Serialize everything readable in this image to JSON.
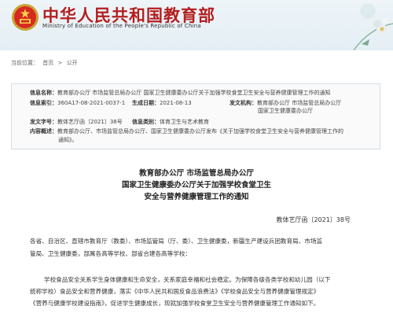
{
  "header": {
    "title": "中华人民共和国教育部",
    "subtitle": "Ministry of Education of the People's Republic of China",
    "emblem_icon": "national-emblem-icon",
    "colors": {
      "title": "#b31f1f",
      "background": "#eef5f9"
    }
  },
  "breadcrumb": {
    "label": "当前位置：",
    "home": "首页",
    "sep": ">",
    "current": "公开"
  },
  "info": {
    "title_label": "信息名称：",
    "title_value": "教育部办公厅  市场监管总局办公厅  国家卫生健康委办公厅关于加强学校食堂卫生安全与营养健康管理工作的通知",
    "index_label": "信息索引：",
    "index_value": "360A17-08-2021-0037-1",
    "date_label": "生成日期：",
    "date_value": "2021-08-13",
    "org_label": "发文机构：",
    "org_value": "教育部办公厅  市场监管总局办公厅",
    "org_value2": "国家卫生健康委办公厅",
    "docno_label": "发文字号：",
    "docno_value": "教体艺厅函〔2021〕38号",
    "category_label": "信息类别：",
    "category_value": "体育卫生与艺术教育",
    "summary_label": "内容概述：",
    "summary_line1": "教育部办公厅、市场监管总局办公厅、国家卫生健康委办公厅发布《关于加强学校食堂卫生安全与营养健康管理工作的",
    "summary_line2": "通知》。"
  },
  "doc": {
    "title_line1": "教育部办公厅  市场监管总局办公厅",
    "title_line2": "国家卫生健康委办公厅关于加强学校食堂卫生",
    "title_line3": "安全与营养健康管理工作的通知",
    "doc_number": "教体艺厅函〔2021〕38号",
    "addressee_line1": "各省、自治区、直辖市教育厅（教委）、市场监管局（厅、委）、卫生健康委，新疆生产建设兵团教育局、市场监",
    "addressee_line2": "管局、卫生健康委，部属各高等学校、部省合建各高等学校：",
    "body_line1": "学校食品安全关系学生身体健康和生命安全，关系家庭幸福和社会稳定。为保障各级各类学校和幼儿园（以下",
    "body_line2": "统称学校）食品安全和营养健康，落实《中华人民共和国反食品浪费法》《学校食品安全与营养健康管理规定》",
    "body_line3": "《营养与健康学校建设指南》，促进学生健康成长，现就加强学校食堂卫生安全与营养健康管理工作通知如下。"
  }
}
